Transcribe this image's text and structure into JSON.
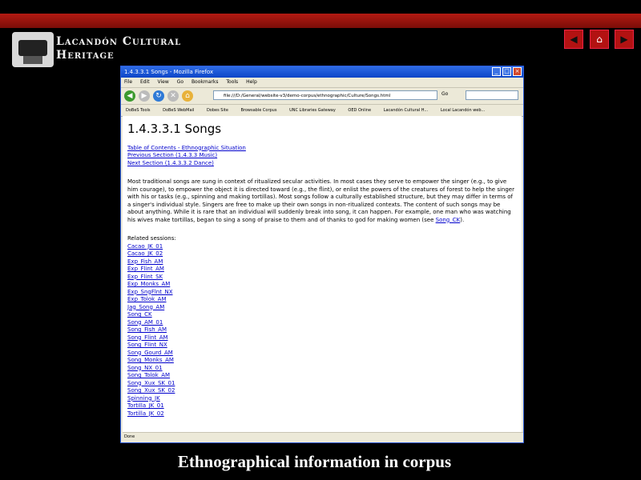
{
  "slide": {
    "brand_line1": "Lacandón Cultural",
    "brand_line2": "Heritage",
    "caption": "Ethnographical information in corpus",
    "nav_prev": "◀",
    "nav_home": "⌂",
    "nav_next": "▶"
  },
  "browser": {
    "title": "1.4.3.3.1 Songs - Mozilla Firefox",
    "menu": [
      "File",
      "Edit",
      "View",
      "Go",
      "Bookmarks",
      "Tools",
      "Help"
    ],
    "url": "file:///D:/General/website-v3/demo-corpus/ethnographic/Culture/Songs.html",
    "go_label": "Go",
    "bookmarks": [
      "DoBeS Tools",
      "DoBeS WebMail",
      "Dobes Site",
      "Browsable Corpus",
      "UNC Libraries Gateway",
      "OED Online",
      "Lacandón Cultural H...",
      "Local Lacandón web..."
    ],
    "status": "Done"
  },
  "page": {
    "heading": "1.4.3.3.1 Songs",
    "toc_link": "Table of Contents - Ethnographic Situation",
    "prev_link": "Previous Section (1.4.3.3 Music)",
    "next_link": "Next Section (1.4.3.3.2 Dance)",
    "body_text": "Most traditional songs are sung in context of ritualized secular activities. In most cases they serve to empower the singer (e.g., to give him courage), to empower the object it is directed toward (e.g., the flint), or enlist the powers of the creatures of forest to help the singer with his or tasks (e.g., spinning and making tortillas). Most songs follow a culturally established structure, but they may differ in terms of a singer's individual style. Singers are free to make up their own songs in non-ritualized contexts. The content of such songs may be about anything. While it is rare that an individual will suddenly break into song, it can happen. For example, one man who was watching his wives make tortillas, began to sing a song of praise to them and of thanks to god for making women (see ",
    "body_link": "Song_CK",
    "body_end": ").",
    "related_label": "Related sessions:",
    "sessions": [
      "Cacao_JK_01",
      "Cacao_JK_02",
      "Exp_Fish_AM",
      "Exp_Flint_AM",
      "Exp_Flint_SK",
      "Exp_Monks_AM",
      "Exp_SngFlnt_NX",
      "Exp_Tolok_AM",
      "Jag_Song_AM",
      "Song_CK",
      "Song_AM_01",
      "Song_Fish_AM",
      "Song_Flint_AM",
      "Song_Flint_NX",
      "Song_Gourd_AM",
      "Song_Monks_AM",
      "Song_NX_01",
      "Song_Tolok_AM",
      "Song_Xux_SK_01",
      "Song_Xux_SK_02",
      "Spinning_JK",
      "Tortilla_JK_01",
      "Tortilla_JK_02"
    ]
  }
}
